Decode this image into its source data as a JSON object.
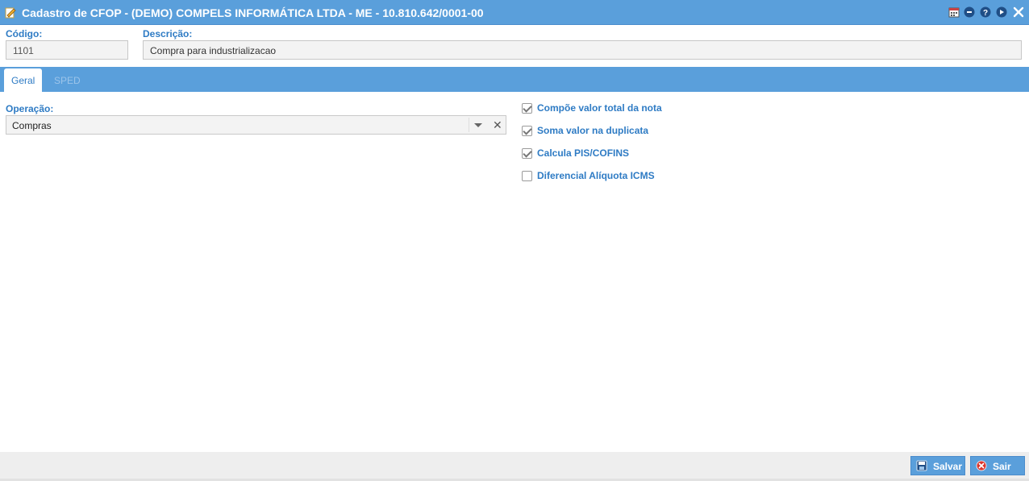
{
  "window": {
    "title": "Cadastro de CFOP - (DEMO) COMPELS INFORMÁTICA LTDA - ME - 10.810.642/0001-00",
    "icons": [
      "edit-icon",
      "calendar-icon",
      "minimize-icon",
      "help-icon",
      "play-icon",
      "close-icon"
    ]
  },
  "form": {
    "codigo_label": "Código:",
    "codigo_value": "1101",
    "descricao_label": "Descrição:",
    "descricao_value": "Compra para industrializacao"
  },
  "tabs": [
    {
      "label": "Geral",
      "active": true
    },
    {
      "label": "SPED",
      "active": false
    }
  ],
  "geral": {
    "operacao_label": "Operação:",
    "operacao_value": "Compras",
    "checkboxes": [
      {
        "label": "Compõe valor total da nota",
        "checked": true
      },
      {
        "label": "Soma valor na duplicata",
        "checked": true
      },
      {
        "label": "Calcula PIS/COFINS",
        "checked": true
      },
      {
        "label": "Diferencial Alíquota ICMS",
        "checked": false
      }
    ]
  },
  "footer": {
    "save_label": "Salvar",
    "exit_label": "Sair"
  },
  "colors": {
    "accent": "#5a9fdb",
    "label": "#2e7bc4"
  }
}
